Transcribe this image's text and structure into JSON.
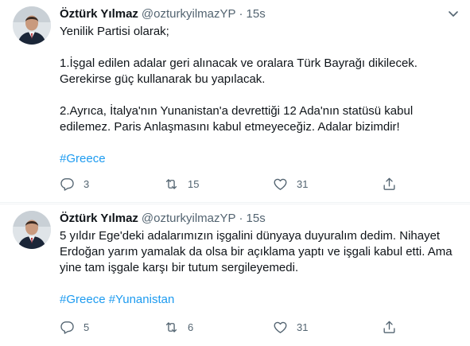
{
  "tweets": [
    {
      "author_name": "Öztürk Yılmaz",
      "handle": "@ozturkyilmazYP",
      "separator": "·",
      "time": "15s",
      "lines": [
        "Yenilik Partisi olarak;",
        "",
        "1.İşgal edilen adalar geri alınacak ve oralara Türk Bayrağı dikilecek.",
        "Gerekirse güç kullanarak bu yapılacak.",
        "",
        "2.Ayrıca, İtalya'nın Yunanistan'a devrettiği 12 Ada'nın statüsü kabul",
        "edilemez. Paris Anlaşmasını kabul etmeyeceğiz. Adalar bizimdir!",
        ""
      ],
      "hashtags": [
        "#Greece"
      ],
      "replies": "3",
      "retweets": "15",
      "likes": "31"
    },
    {
      "author_name": "Öztürk Yılmaz",
      "handle": "@ozturkyilmazYP",
      "separator": "·",
      "time": "15s",
      "lines": [
        "5 yıldır Ege'deki adalarımızın işgalini dünyaya duyuralım dedim. Nihayet",
        "Erdoğan yarım yamalak da olsa bir açıklama yaptı ve işgali kabul etti. Ama",
        "yine tam işgale karşı bir tutum sergileyemedi.",
        ""
      ],
      "hashtags": [
        "#Greece",
        "#Yunanistan"
      ],
      "replies": "5",
      "retweets": "6",
      "likes": "31"
    }
  ],
  "icons": {
    "more": "chevron-down-icon",
    "reply": "reply-icon",
    "retweet": "retweet-icon",
    "like": "heart-icon",
    "share": "share-icon"
  },
  "colors": {
    "text": "#0f1419",
    "secondary": "#536471",
    "link": "#1d9bf0",
    "divider": "#eff3f4"
  }
}
